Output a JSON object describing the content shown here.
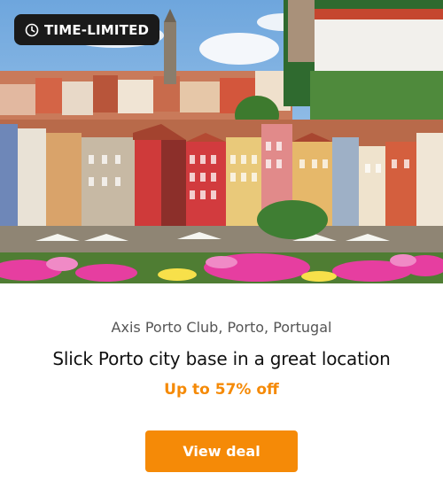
{
  "badge": {
    "label": "TIME-LIMITED",
    "icon": "clock-icon"
  },
  "deal": {
    "location": "Axis Porto Club, Porto, Portugal",
    "title": "Slick Porto city base in a great location",
    "discount": "Up to 57% off"
  },
  "cta": {
    "label": "View deal"
  },
  "colors": {
    "accent": "#f58a07",
    "badge_bg": "#1a1a1a",
    "text_primary": "#111111",
    "text_secondary": "#555555"
  }
}
